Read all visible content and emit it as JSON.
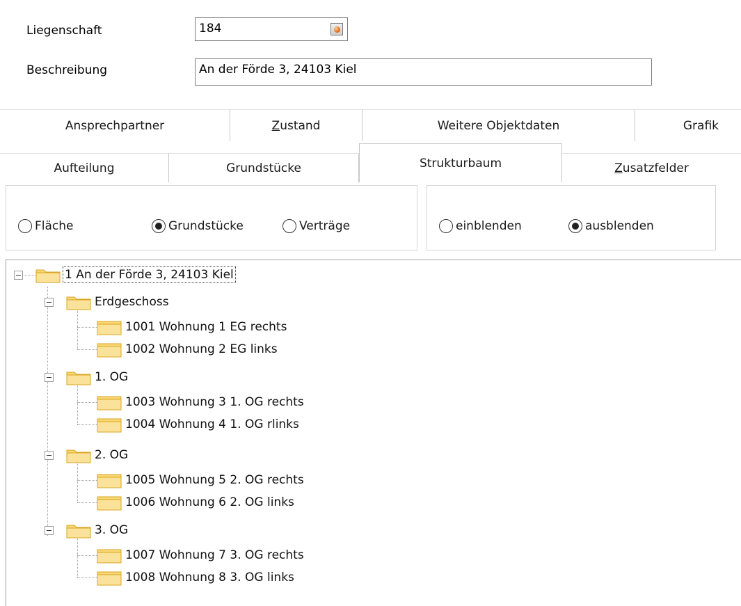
{
  "fields": {
    "liegenschaft_label": "Liegenschaft",
    "liegenschaft_value": "184",
    "beschreibung_label": "Beschreibung",
    "beschreibung_value": "An der Förde 3, 24103 Kiel"
  },
  "tabs_row1": [
    "Ansprechpartner",
    "Zustand",
    "Weitere Objektdaten",
    "Grafik"
  ],
  "tabs_row2": [
    "Aufteilung",
    "Grundstücke",
    "Strukturbaum",
    "Zusatzfelder"
  ],
  "selected_tab": "Strukturbaum",
  "view_options": {
    "options": [
      "Fläche",
      "Grundstücke",
      "Verträge"
    ],
    "selected": "Grundstücke"
  },
  "display_options": {
    "options": [
      "einblenden",
      "ausblenden"
    ],
    "selected": "ausblenden"
  },
  "tree": {
    "root": "1 An der Förde 3, 24103 Kiel",
    "floors": [
      {
        "label": "Erdgeschoss",
        "units": [
          "1001 Wohnung 1 EG rechts",
          "1002 Wohnung 2 EG links"
        ]
      },
      {
        "label": "1. OG",
        "units": [
          "1003 Wohnung 3 1. OG rechts",
          "1004 Wohnung 4 1. OG rlinks"
        ]
      },
      {
        "label": "2. OG",
        "units": [
          "1005 Wohnung 5 2. OG rechts",
          "1006 Wohnung 6 2. OG links"
        ]
      },
      {
        "label": "3. OG",
        "units": [
          "1007 Wohnung 7 3. OG rechts",
          "1008 Wohnung 8 3. OG links"
        ]
      }
    ]
  },
  "icons": {
    "lookup": "lookup-icon",
    "folder": "folder-icon",
    "collapse": "minus-box-icon"
  },
  "colors": {
    "folder_fill": "#f8d775",
    "folder_edge": "#d9a520"
  }
}
